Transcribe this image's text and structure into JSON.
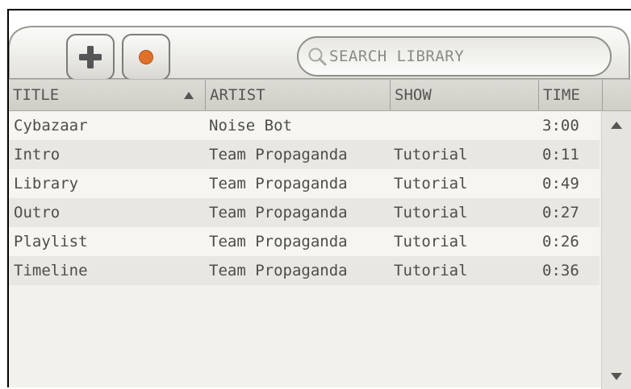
{
  "toolbar": {
    "add_button": {
      "icon": "plus-icon"
    },
    "record_button": {
      "icon": "record-icon",
      "color": "#e0702a"
    },
    "search": {
      "placeholder": "SEARCH LIBRARY",
      "icon": "search-icon"
    }
  },
  "table": {
    "columns": [
      {
        "label": "TITLE",
        "sorted": "ascending"
      },
      {
        "label": "ARTIST"
      },
      {
        "label": "SHOW"
      },
      {
        "label": "TIME"
      }
    ],
    "rows": [
      {
        "title": "Cybazaar",
        "artist": "Noise Bot",
        "show": "",
        "time": "3:00"
      },
      {
        "title": "Intro",
        "artist": "Team Propaganda",
        "show": "Tutorial",
        "time": "0:11"
      },
      {
        "title": "Library",
        "artist": "Team Propaganda",
        "show": "Tutorial",
        "time": "0:49"
      },
      {
        "title": "Outro",
        "artist": "Team Propaganda",
        "show": "Tutorial",
        "time": "0:27"
      },
      {
        "title": "Playlist",
        "artist": "Team Propaganda",
        "show": "Tutorial",
        "time": "0:26"
      },
      {
        "title": "Timeline",
        "artist": "Team Propaganda",
        "show": "Tutorial",
        "time": "0:36"
      }
    ]
  },
  "scrollbar": {
    "up_icon": "triangle-up-icon",
    "down_icon": "triangle-down-icon"
  },
  "colors": {
    "panel_bg": "#f2f1ec",
    "row_alt": "#e8e7e1",
    "header_bg": "#d6d5cf",
    "text": "#4d4d4a"
  }
}
